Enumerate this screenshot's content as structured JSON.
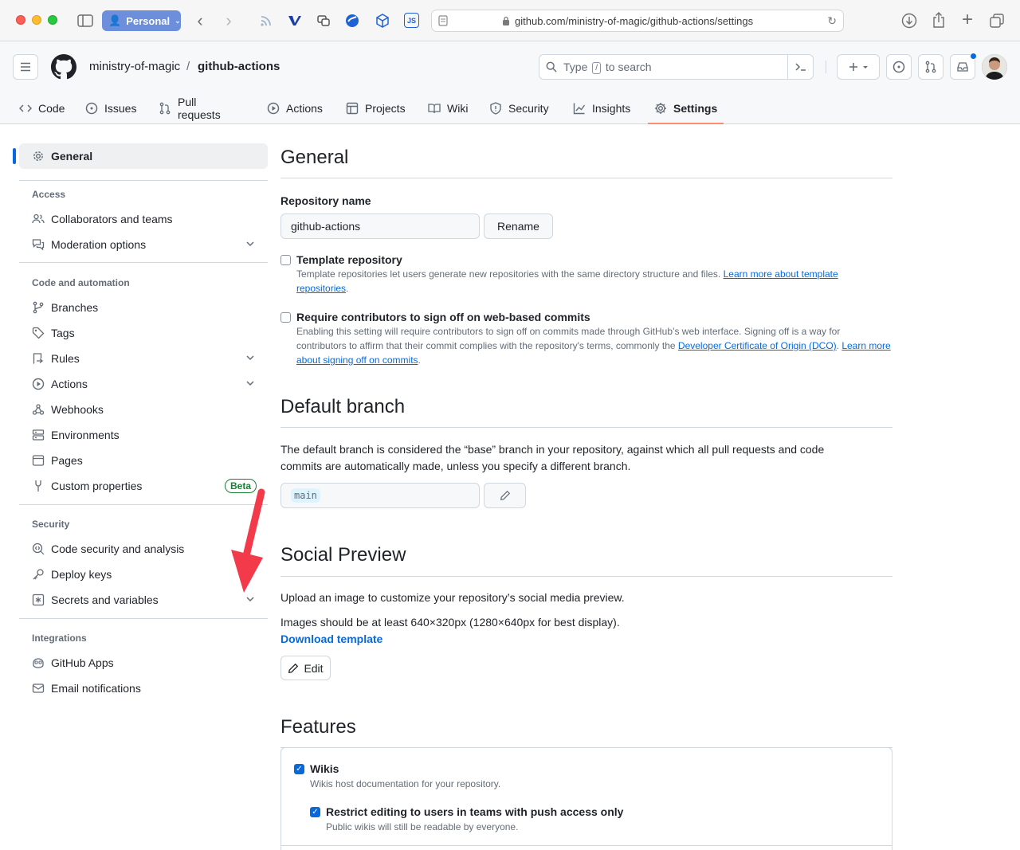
{
  "browser": {
    "profile_label": "Personal",
    "url": "github.com/ministry-of-magic/github-actions/settings",
    "ext_js_label": "JS"
  },
  "header": {
    "owner": "ministry-of-magic",
    "separator": "/",
    "repo": "github-actions",
    "search_before": "Type",
    "search_key": "/",
    "search_after": "to search"
  },
  "tabs": [
    {
      "label": "Code",
      "icon": "code-icon"
    },
    {
      "label": "Issues",
      "icon": "issue-icon"
    },
    {
      "label": "Pull requests",
      "icon": "pull-request-icon"
    },
    {
      "label": "Actions",
      "icon": "play-icon"
    },
    {
      "label": "Projects",
      "icon": "table-icon"
    },
    {
      "label": "Wiki",
      "icon": "book-icon"
    },
    {
      "label": "Security",
      "icon": "shield-icon"
    },
    {
      "label": "Insights",
      "icon": "graph-icon"
    },
    {
      "label": "Settings",
      "icon": "gear-icon",
      "active": true
    }
  ],
  "sidebar": {
    "general": "General",
    "access_heading": "Access",
    "collaborators": "Collaborators and teams",
    "moderation": "Moderation options",
    "code_heading": "Code and automation",
    "branches": "Branches",
    "tags": "Tags",
    "rules": "Rules",
    "actions": "Actions",
    "webhooks": "Webhooks",
    "environments": "Environments",
    "pages": "Pages",
    "custom_properties": "Custom properties",
    "beta": "Beta",
    "security_heading": "Security",
    "code_security": "Code security and analysis",
    "deploy_keys": "Deploy keys",
    "secrets": "Secrets and variables",
    "integrations_heading": "Integrations",
    "github_apps": "GitHub Apps",
    "email_notifications": "Email notifications"
  },
  "general": {
    "title": "General",
    "repo_name_label": "Repository name",
    "repo_name_value": "github-actions",
    "rename_button": "Rename",
    "template_label": "Template repository",
    "template_note": "Template repositories let users generate new repositories with the same directory structure and files.",
    "template_link": "Learn more about template repositories",
    "signoff_label": "Require contributors to sign off on web-based commits",
    "signoff_note": "Enabling this setting will require contributors to sign off on commits made through GitHub’s web interface. Signing off is a way for contributors to affirm that their commit complies with the repository's terms, commonly the",
    "signoff_dco_link": "Developer Certificate of Origin (DCO)",
    "signoff_link": "Learn more about signing off on commits"
  },
  "default_branch": {
    "title": "Default branch",
    "description": "The default branch is considered the “base” branch in your repository, against which all pull requests and code commits are automatically made, unless you specify a different branch.",
    "branch": "main"
  },
  "social": {
    "title": "Social Preview",
    "line1": "Upload an image to customize your repository’s social media preview.",
    "line2": "Images should be at least 640×320px (1280×640px for best display).",
    "download": "Download template",
    "edit_button": "Edit"
  },
  "features": {
    "title": "Features",
    "wikis_label": "Wikis",
    "wikis_note": "Wikis host documentation for your repository.",
    "wikis_checked": true,
    "restrict_label": "Restrict editing to users in teams with push access only",
    "restrict_note": "Public wikis will still be readable by everyone.",
    "restrict_checked": true
  },
  "colors": {
    "accent": "#0969da",
    "tab_underline": "#fd8c73",
    "arrow": "#f23a4b",
    "beta": "#1a7f37"
  }
}
